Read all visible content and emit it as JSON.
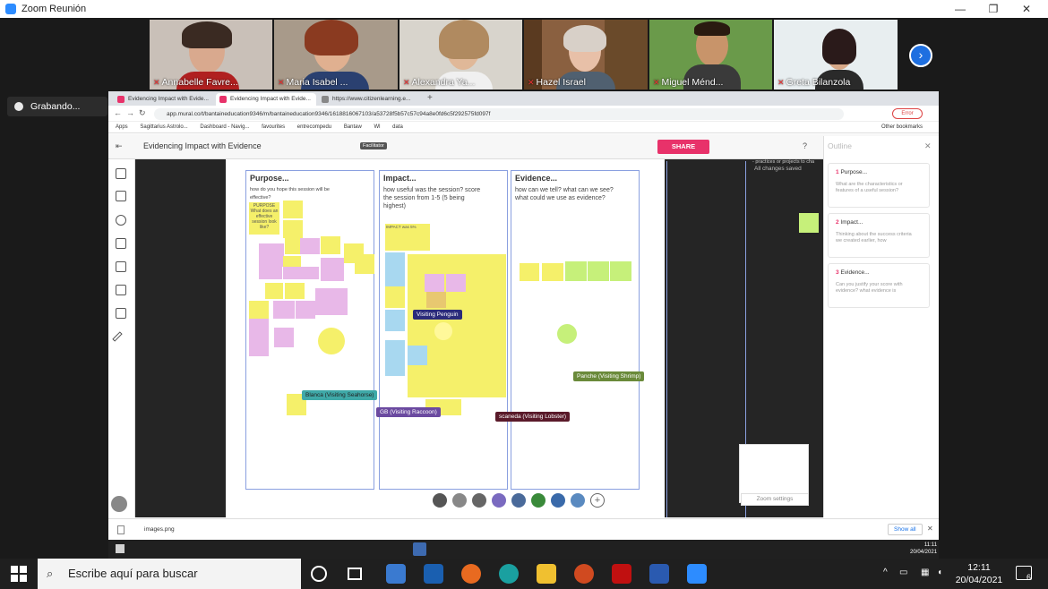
{
  "window": {
    "title": "Zoom Reunión",
    "minimize": "—",
    "maximize": "❐",
    "close": "✕"
  },
  "participants": [
    {
      "name": "Annabelle Favre..."
    },
    {
      "name": "Maria Isabel ..."
    },
    {
      "name": "Alexandra Ya..."
    },
    {
      "name": "Hazel Israel"
    },
    {
      "name": "Miguel Ménd..."
    },
    {
      "name": "Greta Bilanzola"
    }
  ],
  "recording": {
    "label": "Grabando..."
  },
  "browser": {
    "tabs": [
      {
        "label": "Evidencing Impact with Evide..."
      },
      {
        "label": "Evidencing Impact with Evide..."
      },
      {
        "label": "https://www.citizenlearning.e..."
      }
    ],
    "url": "app.mural.co/t/bantaineducation9346/m/bantaineducation9346/1618816067103/a53728f5b57c57c94a8e0fd6c5f292575fd097f",
    "bookmarks": [
      "Apps",
      "Sagittarius Astrolo...",
      "Dashboard - Navig...",
      "favourites",
      "entrecompedu",
      "Bantaw",
      "Wl",
      "data",
      "Other bookmarks"
    ],
    "profile": "Error"
  },
  "mural": {
    "title": "Evidencing Impact with Evidence",
    "facilitator": "Facilitator",
    "share": "SHARE",
    "saved": "All changes saved",
    "outline_title": "Outline",
    "outline": [
      {
        "num": "1",
        "title": "Purpose...",
        "desc": "What are the characteristics or features of a useful session?"
      },
      {
        "num": "2",
        "title": "Impact...",
        "desc": "Thinking about the success criteria we created earlier, how"
      },
      {
        "num": "3",
        "title": "Evidence...",
        "desc": "Can you justify your score with evidence? what evidence is"
      }
    ],
    "columns": [
      {
        "title": "Purpose...",
        "sub": "how do you hope this session will be effective?"
      },
      {
        "title": "Impact...",
        "sub": "how useful was the session? score the session from 1-5 (5 being highest)"
      },
      {
        "title": "Evidence...",
        "sub": "how can we tell? what can we see? what could we use as evidence?"
      }
    ],
    "cursors": [
      {
        "label": "Visiting Penguin",
        "color": "#2b2b7a"
      },
      {
        "label": "Blanca (Visiting Seahorse)",
        "color": "#3fa9a8"
      },
      {
        "label": "GB (Visiting Raccoon)",
        "color": "#6b4aa0"
      },
      {
        "label": "scaneda (Visiting Lobster)",
        "color": "#5a1a2a"
      },
      {
        "label": "Panche (Visiting Shrimp)",
        "color": "#6a8a3a"
      }
    ],
    "zoom_settings": "Zoom settings",
    "sticky_purpose": "PURPOSE What does an effective session look like?",
    "sticky_impact": "IMPACT was 5%",
    "tiny_note": "- practices or projects to cha"
  },
  "download": {
    "file": "images.png",
    "show_all": "Show all"
  },
  "inner_clock": {
    "time": "11:11",
    "date": "20/04/2021"
  },
  "taskbar": {
    "search_placeholder": "Escribe aquí para buscar",
    "time": "12:11",
    "date": "20/04/2021",
    "notifications": "6"
  }
}
